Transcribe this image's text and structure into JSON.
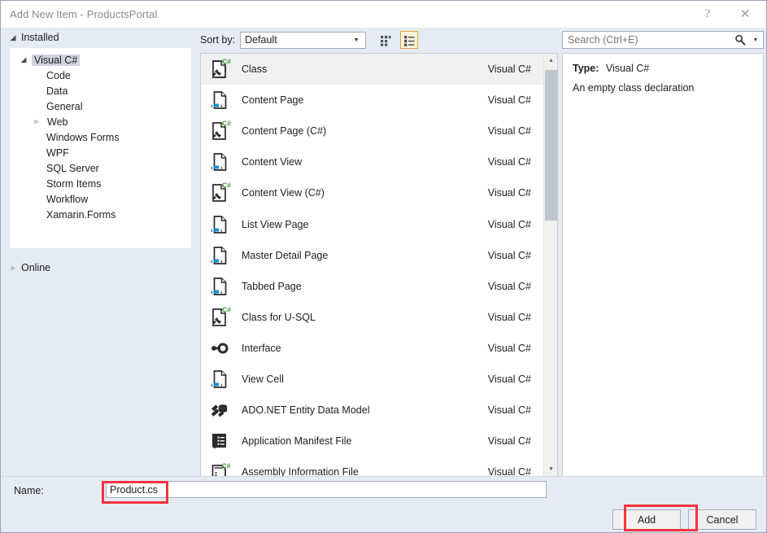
{
  "window": {
    "title": "Add New Item - ProductsPortal",
    "help_icon": "?",
    "close_icon": "✕"
  },
  "sidebar": {
    "installed_label": "Installed",
    "installed_expand_icon": "◢",
    "online_label": "Online",
    "online_expand_icon": "▹",
    "tree": [
      {
        "label": "Visual C#",
        "level": 1,
        "selected": true,
        "expander": "◢"
      },
      {
        "label": "Code",
        "level": 2,
        "selected": false,
        "expander": ""
      },
      {
        "label": "Data",
        "level": 2,
        "selected": false,
        "expander": ""
      },
      {
        "label": "General",
        "level": 2,
        "selected": false,
        "expander": ""
      },
      {
        "label": "Web",
        "level": 2,
        "selected": false,
        "expander": "▹"
      },
      {
        "label": "Windows Forms",
        "level": 2,
        "selected": false,
        "expander": ""
      },
      {
        "label": "WPF",
        "level": 2,
        "selected": false,
        "expander": ""
      },
      {
        "label": "SQL Server",
        "level": 2,
        "selected": false,
        "expander": ""
      },
      {
        "label": "Storm Items",
        "level": 2,
        "selected": false,
        "expander": ""
      },
      {
        "label": "Workflow",
        "level": 2,
        "selected": false,
        "expander": ""
      },
      {
        "label": "Xamarin.Forms",
        "level": 2,
        "selected": false,
        "expander": ""
      }
    ]
  },
  "toolbar": {
    "sort_by_label": "Sort by:",
    "sort_by_value": "Default",
    "sort_by_options": [
      "Default"
    ],
    "dropdown_arrow_icon": "▼",
    "view_tiles_icon": "medium-icons-view-icon",
    "view_details_icon": "details-view-icon"
  },
  "search": {
    "placeholder": "Search (Ctrl+E)",
    "value": "",
    "icon": "search-icon",
    "dropdown_arrow_icon": "▼"
  },
  "templates": {
    "lang_column": "Visual C#",
    "items": [
      {
        "name": "Class",
        "lang": "Visual C#",
        "icon": "csharp-class-file-icon",
        "selected": true
      },
      {
        "name": "Content Page",
        "lang": "Visual C#",
        "icon": "xaml-page-file-icon",
        "selected": false
      },
      {
        "name": "Content Page (C#)",
        "lang": "Visual C#",
        "icon": "csharp-class-file-icon",
        "selected": false
      },
      {
        "name": "Content View",
        "lang": "Visual C#",
        "icon": "xaml-page-file-icon",
        "selected": false
      },
      {
        "name": "Content View (C#)",
        "lang": "Visual C#",
        "icon": "csharp-class-file-icon",
        "selected": false
      },
      {
        "name": "List View Page",
        "lang": "Visual C#",
        "icon": "xaml-page-file-icon",
        "selected": false
      },
      {
        "name": "Master Detail Page",
        "lang": "Visual C#",
        "icon": "xaml-page-file-icon",
        "selected": false
      },
      {
        "name": "Tabbed Page",
        "lang": "Visual C#",
        "icon": "xaml-page-file-icon",
        "selected": false
      },
      {
        "name": "Class for U-SQL",
        "lang": "Visual C#",
        "icon": "csharp-class-file-icon",
        "selected": false
      },
      {
        "name": "Interface",
        "lang": "Visual C#",
        "icon": "interface-lollipop-icon",
        "selected": false
      },
      {
        "name": "View Cell",
        "lang": "Visual C#",
        "icon": "xaml-page-file-icon",
        "selected": false
      },
      {
        "name": "ADO.NET Entity Data Model",
        "lang": "Visual C#",
        "icon": "entity-data-model-icon",
        "selected": false
      },
      {
        "name": "Application Manifest File",
        "lang": "Visual C#",
        "icon": "manifest-file-icon",
        "selected": false
      },
      {
        "name": "Assembly Information File",
        "lang": "Visual C#",
        "icon": "csharp-info-file-icon",
        "selected": false
      }
    ],
    "scrollbar": {
      "up_arrow_icon": "▲",
      "down_arrow_icon": "▼"
    }
  },
  "details": {
    "type_label": "Type:",
    "type_value": "Visual C#",
    "description": "An empty class declaration"
  },
  "footer": {
    "name_label": "Name:",
    "name_value": "Product.cs",
    "add_label": "Add",
    "cancel_label": "Cancel"
  },
  "colors": {
    "dialog_background": "#e6eaf2",
    "panel_background": "#ffffff",
    "selected_row": "#f0f0f0",
    "tree_selection": "#cdd2de",
    "view_toggle_active_border": "#d9a441",
    "view_toggle_active_fill": "#fdf4d8",
    "annotation_red": "#f5333f",
    "csharp_green": "#3f9c35",
    "xaml_blue": "#0e8fd6"
  }
}
